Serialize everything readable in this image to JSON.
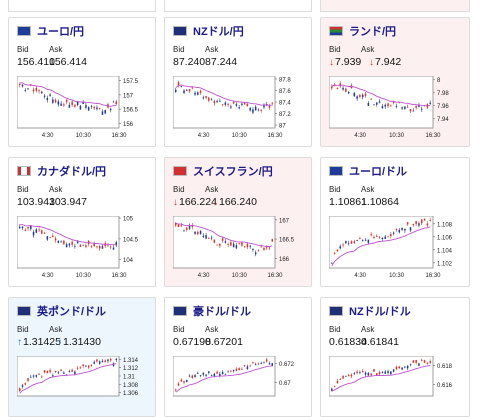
{
  "colors": {
    "candle_up": "#e03020",
    "candle_down": "#1f3a9a",
    "moving_average": "#c050d0",
    "title_link": "#1a1a8a",
    "arrow_down": "#d23a2a",
    "arrow_up": "#1f6fd0",
    "card_down_bg": "#fdf0f0",
    "card_up_bg": "#eef6fd"
  },
  "labels": {
    "bid": "Bid",
    "ask": "Ask"
  },
  "cards": [
    {
      "title": "ユーロ/円",
      "flag_icon": "eu-flag-icon",
      "state": "neutral",
      "arrow": "",
      "bid": "156.410",
      "ask": "156.414",
      "yticks": [
        "157.5",
        "157",
        "156.5",
        "156"
      ],
      "ylim": [
        155.85,
        157.65
      ],
      "xticks": [
        "4:30",
        "10:30",
        "16:30"
      ],
      "trend": "down-dip-up"
    },
    {
      "title": "NZドル/円",
      "flag_icon": "nz-flag-icon",
      "state": "neutral",
      "arrow": "",
      "bid": "87.240",
      "ask": "87.244",
      "yticks": [
        "87.8",
        "87.6",
        "87.4",
        "87.2",
        "87"
      ],
      "ylim": [
        86.95,
        87.85
      ],
      "xticks": [
        "4:30",
        "10:30",
        "16:30"
      ],
      "trend": "down-dip-up"
    },
    {
      "title": "ランド/円",
      "flag_icon": "za-flag-icon",
      "state": "down",
      "arrow": "↓",
      "bid": "7.939",
      "ask": "7.942",
      "yticks": [
        "8",
        "7.98",
        "7.96",
        "7.94"
      ],
      "ylim": [
        7.925,
        8.005
      ],
      "xticks": [
        "4:30",
        "10:30",
        "16:30"
      ],
      "trend": "down-dip-up"
    },
    {
      "title": "カナダドル/円",
      "flag_icon": "ca-flag-icon",
      "state": "neutral",
      "arrow": "",
      "bid": "103.943",
      "ask": "103.947",
      "yticks": [
        "105",
        "104.5",
        "104"
      ],
      "ylim": [
        103.8,
        105.05
      ],
      "xticks": [
        "4:30",
        "10:30",
        "16:30"
      ],
      "trend": "down-dip-up"
    },
    {
      "title": "スイスフラン/円",
      "flag_icon": "ch-flag-icon",
      "state": "down",
      "arrow": "↓",
      "bid": "166.224",
      "ask": "166.240",
      "yticks": [
        "167",
        "166.5",
        "166"
      ],
      "ylim": [
        165.75,
        167.1
      ],
      "xticks": [
        "4:30",
        "10:30",
        "16:30"
      ],
      "trend": "down-dip-up"
    },
    {
      "title": "ユーロ/ドル",
      "flag_icon": "eu-us-flag-icon",
      "state": "neutral",
      "arrow": "",
      "bid": "1.10861",
      "ask": "1.10864",
      "yticks": [
        "1.108",
        "1.106",
        "1.104",
        "1.102"
      ],
      "ylim": [
        1.1012,
        1.1092
      ],
      "xticks": [
        "4:30",
        "10:30",
        "16:30"
      ],
      "trend": "up"
    },
    {
      "title": "英ポンド/ドル",
      "flag_icon": "gb-us-flag-icon",
      "state": "up",
      "arrow": "↑",
      "bid": "1.31425",
      "ask": "1.31430",
      "yticks": [
        "1.314",
        "1.312",
        "1.31",
        "1.308",
        "1.306"
      ],
      "ylim": [
        1.3052,
        1.3148
      ],
      "xticks": [],
      "trend": "up"
    },
    {
      "title": "豪ドル/ドル",
      "flag_icon": "au-us-flag-icon",
      "state": "neutral",
      "arrow": "",
      "bid": "0.67198",
      "ask": "0.67201",
      "yticks": [
        "0.672",
        "0.67"
      ],
      "ylim": [
        0.6686,
        0.6728
      ],
      "xticks": [],
      "trend": "up"
    },
    {
      "title": "NZドル/ドル",
      "flag_icon": "nz-us-flag-icon",
      "state": "neutral",
      "arrow": "",
      "bid": "0.61834",
      "ask": "0.61841",
      "yticks": [
        "0.618",
        "0.616"
      ],
      "ylim": [
        0.6148,
        0.619
      ],
      "xticks": [],
      "trend": "up"
    }
  ]
}
